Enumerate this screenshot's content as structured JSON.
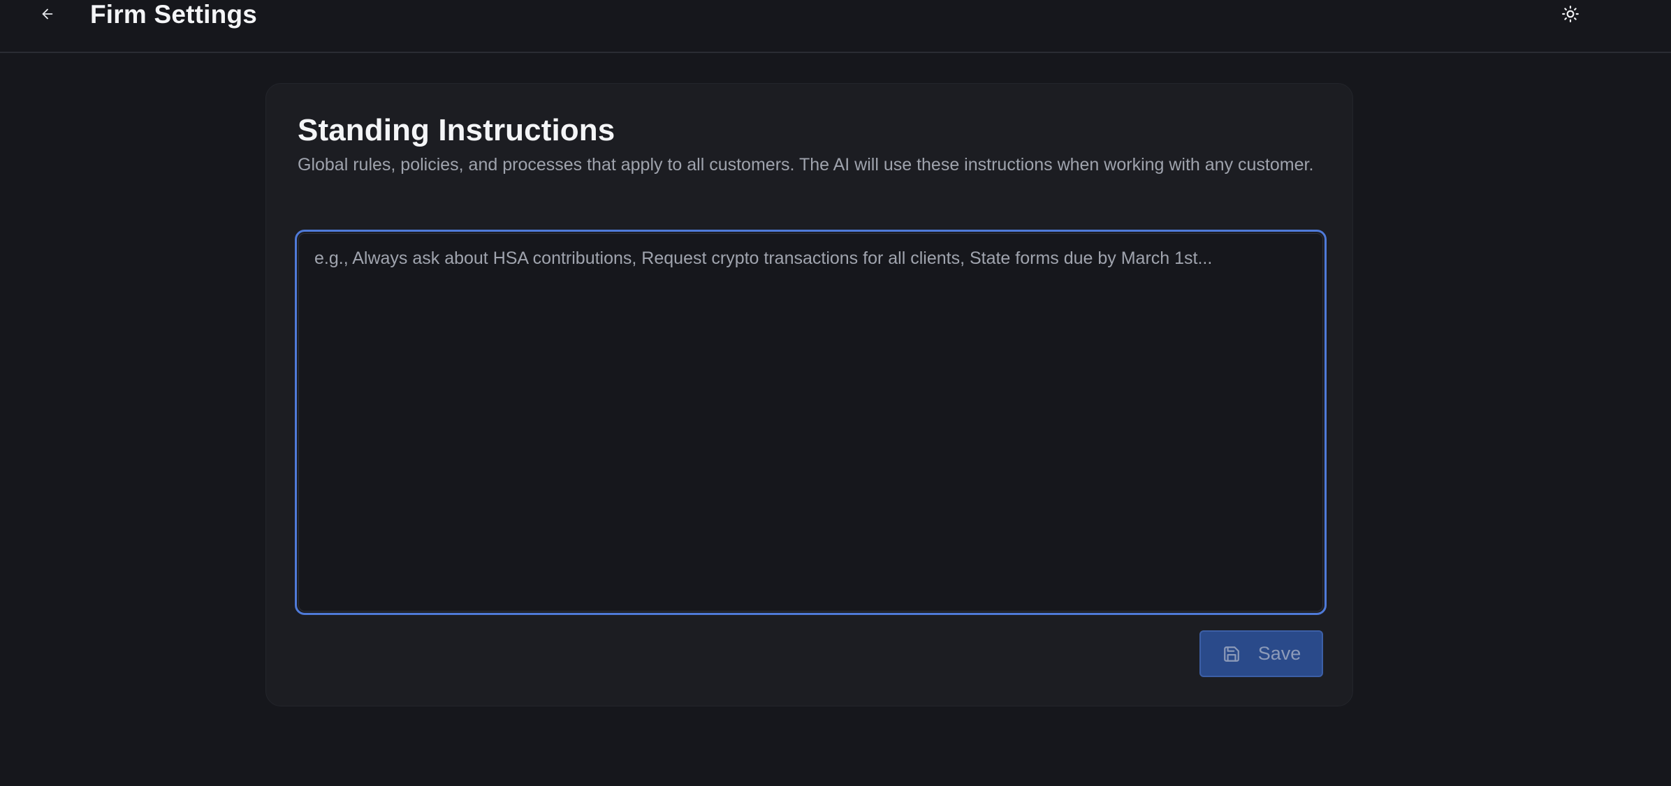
{
  "header": {
    "back_icon": "arrow-left-icon",
    "title": "Firm Settings",
    "theme_icon": "sun-icon"
  },
  "card": {
    "title": "Standing Instructions",
    "description": "Global rules, policies, and processes that apply to all customers. The AI will use these instructions when working with any customer.",
    "textarea": {
      "value": "",
      "placeholder": "e.g., Always ask about HSA contributions, Request crypto transactions for all clients, State forms due by March 1st..."
    },
    "save_button": {
      "label": "Save",
      "icon": "save-icon",
      "disabled": true
    }
  },
  "colors": {
    "background": "#16171c",
    "card": "#1c1d22",
    "focus_ring": "#4f7ad8",
    "button_bg": "#2a4a8a"
  }
}
